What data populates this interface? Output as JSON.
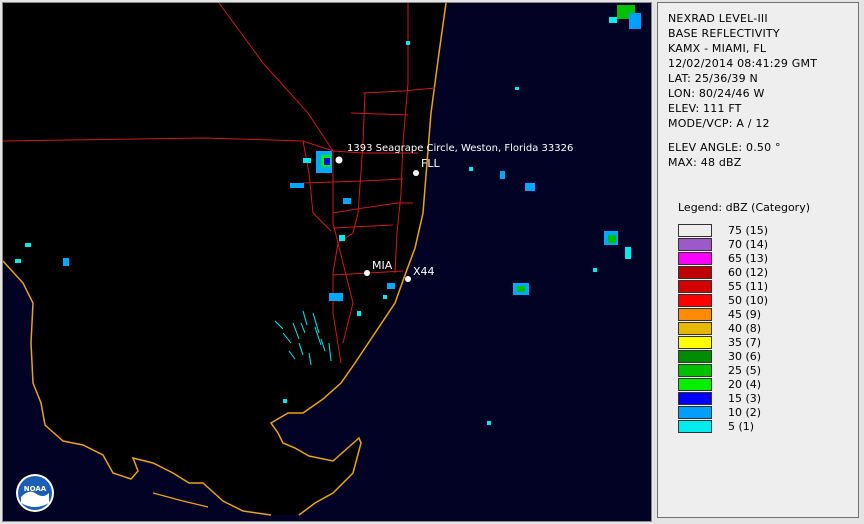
{
  "map": {
    "labels": {
      "address": "1393 Seagrape Circle, Weston, Florida 33326",
      "fll": "FLL",
      "mia": "MIA",
      "x44": "X44"
    },
    "colors": {
      "background": "#020224",
      "land": "#000000",
      "coastline": "#e8a317",
      "roads": "#cc1a1a",
      "marker": "#ffffff"
    },
    "logo": "noaa-logo"
  },
  "info": {
    "product": "NEXRAD LEVEL-III",
    "type": "BASE REFLECTIVITY",
    "station": "KAMX - MIAMI, FL",
    "datetime": "12/02/2014 08:41:29 GMT",
    "lat": "LAT: 25/36/39 N",
    "lon": "LON: 80/24/46 W",
    "elev": "ELEV: 111 FT",
    "mode": "MODE/VCP: A / 12",
    "elev_angle": "ELEV ANGLE: 0.50 °",
    "max": "MAX: 48 dBZ"
  },
  "legend": {
    "title": "Legend: dBZ (Category)",
    "items": [
      {
        "label": "75  (15)",
        "color": "#eeeeee"
      },
      {
        "label": "70  (14)",
        "color": "#9b59c9"
      },
      {
        "label": "65  (13)",
        "color": "#ff00ff"
      },
      {
        "label": "60  (12)",
        "color": "#bf0000"
      },
      {
        "label": "55  (11)",
        "color": "#d40000"
      },
      {
        "label": "50  (10)",
        "color": "#ff0000"
      },
      {
        "label": "45  (9)",
        "color": "#ff8c00"
      },
      {
        "label": "40  (8)",
        "color": "#e6b800"
      },
      {
        "label": "35  (7)",
        "color": "#ffff00"
      },
      {
        "label": "30  (6)",
        "color": "#008c00"
      },
      {
        "label": "25  (5)",
        "color": "#00c000"
      },
      {
        "label": "20  (4)",
        "color": "#00f000"
      },
      {
        "label": "15  (3)",
        "color": "#0000f6"
      },
      {
        "label": "10  (2)",
        "color": "#009eff"
      },
      {
        "label": "5  (1)",
        "color": "#00ecec"
      }
    ]
  }
}
